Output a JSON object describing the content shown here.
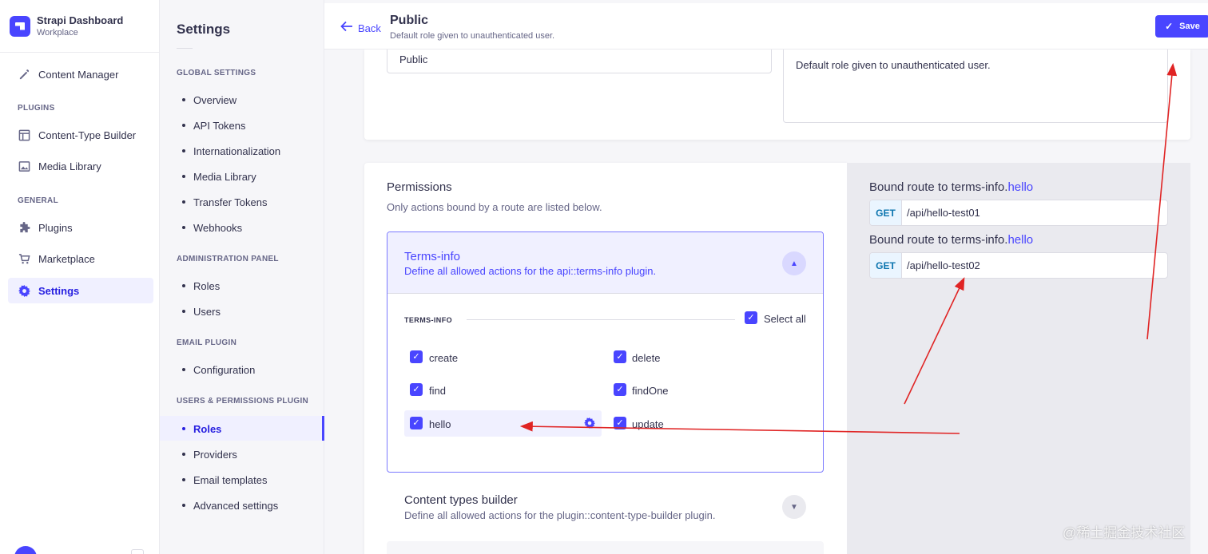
{
  "brand": {
    "title": "Strapi Dashboard",
    "subtitle": "Workplace"
  },
  "leftnav": {
    "content_manager": "Content Manager",
    "plugins_section": "PLUGINS",
    "content_type_builder": "Content-Type Builder",
    "media_library": "Media Library",
    "general_section": "GENERAL",
    "plugins": "Plugins",
    "marketplace": "Marketplace",
    "settings": "Settings"
  },
  "subnav": {
    "title": "Settings",
    "global_section": "GLOBAL SETTINGS",
    "global_items": [
      "Overview",
      "API Tokens",
      "Internationalization",
      "Media Library",
      "Transfer Tokens",
      "Webhooks"
    ],
    "admin_section": "ADMINISTRATION PANEL",
    "admin_items": [
      "Roles",
      "Users"
    ],
    "email_section": "EMAIL PLUGIN",
    "email_items": [
      "Configuration"
    ],
    "up_section": "USERS & PERMISSIONS PLUGIN",
    "up_items": [
      "Roles",
      "Providers",
      "Email templates",
      "Advanced settings"
    ]
  },
  "header": {
    "back_label": "Back",
    "title": "Public",
    "subtitle": "Default role given to unauthenticated user.",
    "save_label": "Save"
  },
  "role_form": {
    "name_value": "Public",
    "description_value": "Default role given to unauthenticated user."
  },
  "permissions": {
    "title": "Permissions",
    "subtitle": "Only actions bound by a route are listed below.",
    "open_section": {
      "title": "Terms-info",
      "description": "Define all allowed actions for the api::terms-info plugin.",
      "group_label": "TERMS-INFO",
      "select_all_label": "Select all",
      "actions": [
        "create",
        "delete",
        "find",
        "findOne",
        "hello",
        "update"
      ],
      "all_checked": true
    },
    "closed_section": {
      "title": "Content types builder",
      "description": "Define all allowed actions for the plugin::content-type-builder plugin."
    }
  },
  "routes": [
    {
      "prefix": "Bound route to terms-info.",
      "action": "hello",
      "method": "GET",
      "path": "/api/hello-test01"
    },
    {
      "prefix": "Bound route to terms-info.",
      "action": "hello",
      "method": "GET",
      "path": "/api/hello-test02"
    }
  ],
  "colors": {
    "accent": "#4945ff",
    "annotation_arrow": "#e02424"
  },
  "watermark": "@稀土掘金技术社区"
}
